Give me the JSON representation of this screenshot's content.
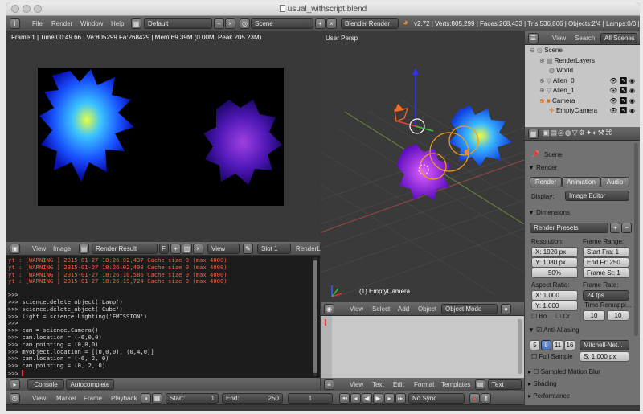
{
  "window": {
    "title": "usual_withscript.blend"
  },
  "menubar": {
    "menus": [
      "File",
      "Render",
      "Window",
      "Help"
    ],
    "layout": "Default",
    "scene": "Scene",
    "engine": "Blender Render",
    "stats": "v2.72 | Verts:805,299 | Faces:268,433 | Tris:536,866 | Objects:2/4 | Lamps:0/0 | Mem:"
  },
  "render_view": {
    "frame_info": "Frame:1 | Time:00:49.66 | Ve:805299 Fa:268429 | Mem:69.39M (0.00M, Peak 205.23M)"
  },
  "image_header": {
    "view": "View",
    "image": "Image",
    "image_name": "Render Result",
    "f_label": "F",
    "view_menu": "View",
    "slot": "Slot 1",
    "render_layer": "RenderLa"
  },
  "viewport": {
    "label": "User Persp",
    "object_label": "(1) EmptyCamera"
  },
  "viewport_header": {
    "menus": [
      "View",
      "Select",
      "Add",
      "Object"
    ],
    "mode": "Object Mode"
  },
  "console": {
    "warnings": [
      "yt : [WARNING  ] 2015-01-27 18:26:02,437 Cache size           0 (max      4000)",
      "yt : [WARNING  ] 2015-01-27 18:26:02,400 Cache size           0 (max      4000)",
      "yt : [WARNING  ] 2015-01-27 18:26:10,586 Cache size           0 (max      4000)",
      "yt : [WARNING  ] 2015-01-27 18:26:19,724 Cache size           0 (max      4000)"
    ],
    "lines": [
      ">>>",
      ">>> science.delete_object('Lamp')",
      ">>> science.delete_object('Cube')",
      ">>> light = science.Lighting('EMISSION')",
      ">>>",
      ">>> cam = science.Camera()",
      ">>> cam.location = (-6,0,0)",
      ">>> cam.pointing = (0,0,0)",
      ">>> myobject.location = [(0,0,0), (0,4,0)]",
      ">>> cam.location = (-6, 2, 0)",
      ">>> cam.pointing = (0, 2, 0)",
      ">>> "
    ],
    "tabs": [
      "Console",
      "Autocomplete"
    ]
  },
  "text_header": {
    "menus": [
      "View",
      "Text",
      "Edit",
      "Format",
      "Templates"
    ],
    "type": "Text"
  },
  "timeline": {
    "menus": [
      "View",
      "Marker",
      "Frame",
      "Playback"
    ],
    "start_label": "Start:",
    "start": "1",
    "end_label": "End:",
    "end": "250",
    "current": "1",
    "sync": "No Sync"
  },
  "outliner": {
    "tabs": [
      "View",
      "Search",
      "All Scenes"
    ],
    "items": [
      {
        "label": "Scene",
        "indent": 0
      },
      {
        "label": "RenderLayers",
        "indent": 1
      },
      {
        "label": "World",
        "indent": 1
      },
      {
        "label": "Allen_0",
        "indent": 1
      },
      {
        "label": "Allen_1",
        "indent": 1
      },
      {
        "label": "Camera",
        "indent": 1
      },
      {
        "label": "EmptyCamera",
        "indent": 1
      }
    ]
  },
  "properties": {
    "scene_label": "Scene",
    "render": {
      "title": "Render",
      "buttons": [
        "Render",
        "Animation",
        "Audio"
      ],
      "display_label": "Display:",
      "display": "Image Editor"
    },
    "dimensions": {
      "title": "Dimensions",
      "preset": "Render Presets",
      "resolution_label": "Resolution:",
      "res_x": "X:  1920 px",
      "res_y": "Y:  1080 px",
      "res_pct": "50%",
      "frame_range_label": "Frame Range:",
      "start": "Start Fra: 1",
      "end": "End Fr: 250",
      "step": "Frame St: 1",
      "aspect_label": "Aspect Ratio:",
      "asp_x": "X:   1.000",
      "asp_y": "Y:   1.000",
      "frame_rate_label": "Frame Rate:",
      "fps": "24 fps",
      "time_remap_label": "Time Remappi...",
      "remap_old": "10",
      "remap_new": "10",
      "border": "Bo",
      "crop": "Cr"
    },
    "aa": {
      "title": "Anti-Aliasing",
      "samples": [
        "5",
        "8",
        "11",
        "16"
      ],
      "filter": "Mitchell-Net...",
      "full_sample": "Full Sample",
      "size": "S: 1.000 px"
    },
    "collapsed": [
      "Sampled Motion Blur",
      "Shading",
      "Performance"
    ]
  }
}
